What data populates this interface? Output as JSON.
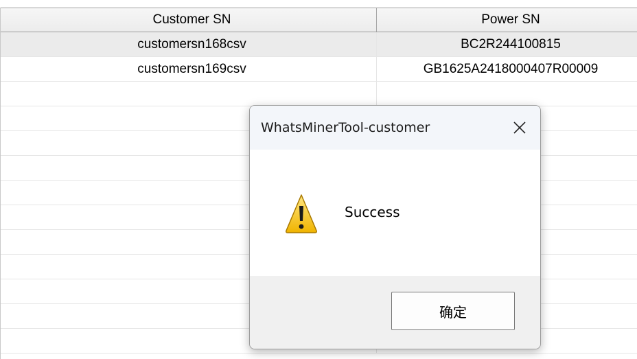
{
  "table": {
    "columns": [
      "Customer SN",
      "Power SN"
    ],
    "rows": [
      [
        "customersn168csv",
        "BC2R244100815"
      ],
      [
        "customersn169csv",
        "GB1625A2418000407R00009"
      ]
    ]
  },
  "dialog": {
    "title": "WhatsMinerTool-customer",
    "message": "Success",
    "ok_label": "确定",
    "icon": "warning-icon"
  },
  "colors": {
    "selected_row": "#ebebeb",
    "header_bg": "#ececec",
    "dialog_title_bg": "#f3f6fa",
    "warning_yellow": "#f5c400"
  }
}
